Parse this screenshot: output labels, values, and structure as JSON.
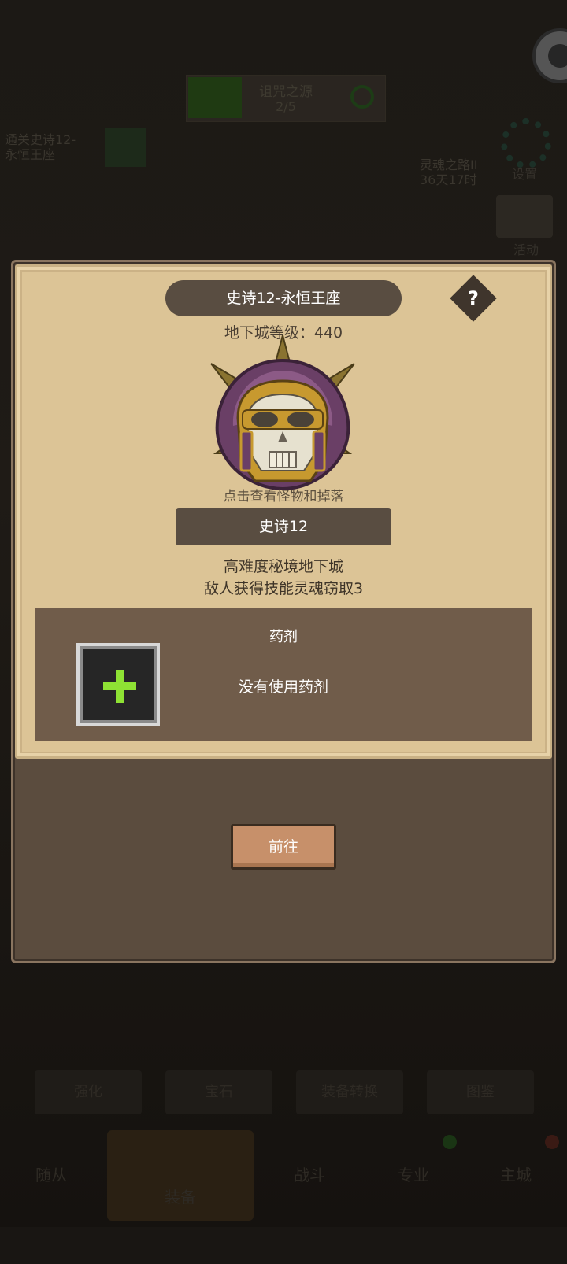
{
  "background": {
    "top_banner": {
      "title": "诅咒之源",
      "progress": "2/5"
    },
    "quest": {
      "line1": "通关史诗12-",
      "line2": "永恒王座"
    },
    "soul_road": {
      "title": "灵魂之路II",
      "timer": "36天17时"
    },
    "settings_label": "设置",
    "event_label": "活动",
    "tabs": [
      "强化",
      "宝石",
      "装备转换",
      "图鉴"
    ],
    "nav": [
      "随从",
      "装备",
      "战斗",
      "专业",
      "主城"
    ]
  },
  "dialog": {
    "title": "史诗12-永恒王座",
    "help": "?",
    "dungeon_level_label": "地下城等级：",
    "dungeon_level": "440",
    "hint": "点击查看怪物和掉落",
    "difficulty": "史诗12",
    "desc_line1": "高难度秘境地下城",
    "desc_line2": "敌人获得技能灵魂窃取3",
    "potion": {
      "title": "药剂",
      "status": "没有使用药剂",
      "slot_icon": "plus-icon"
    },
    "go_label": "前往"
  },
  "colors": {
    "panel": "#dcc496",
    "dark_bar": "#594d41",
    "potion_panel": "#705c4a",
    "plus": "#8ee234",
    "button": "#c7906a"
  }
}
